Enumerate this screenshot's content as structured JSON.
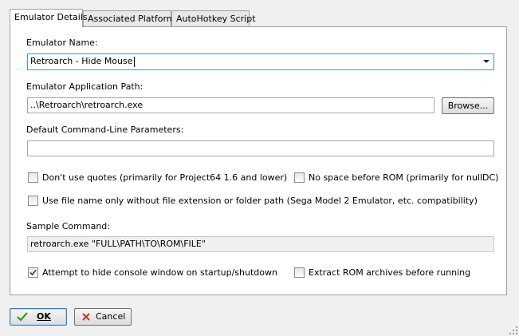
{
  "tabs": [
    {
      "label": "Emulator Details",
      "active": true
    },
    {
      "label": "Associated Platforms",
      "active": false
    },
    {
      "label": "AutoHotkey Script",
      "active": false
    }
  ],
  "emulator_name": {
    "label": "Emulator Name:",
    "value": "Retroarch - Hide Mouse"
  },
  "app_path": {
    "label": "Emulator Application Path:",
    "value": "..\\Retroarch\\retroarch.exe",
    "browse_label": "Browse..."
  },
  "cmdline": {
    "label": "Default Command-Line Parameters:",
    "value": ""
  },
  "options": {
    "dont_use_quotes": {
      "label": "Don't use quotes (primarily for Project64 1.6 and lower)",
      "checked": false
    },
    "no_space_before_rom": {
      "label": "No space before ROM (primarily for nullDC)",
      "checked": false
    },
    "file_name_only": {
      "label": "Use file name only without file extension or folder path (Sega Model 2 Emulator, etc. compatibility)",
      "checked": false
    },
    "hide_console": {
      "label": "Attempt to hide console window on startup/shutdown",
      "checked": true
    },
    "extract_rom": {
      "label": "Extract ROM archives before running",
      "checked": false
    }
  },
  "sample_command": {
    "label": "Sample Command:",
    "value": "retroarch.exe \"FULL\\PATH\\TO\\ROM\\FILE\""
  },
  "footer": {
    "ok_label": "OK",
    "cancel_label": "Cancel"
  },
  "colors": {
    "ok_check": "#3a9a1e",
    "cancel_x": "#c0392b",
    "focus_border": "#3399ff"
  }
}
